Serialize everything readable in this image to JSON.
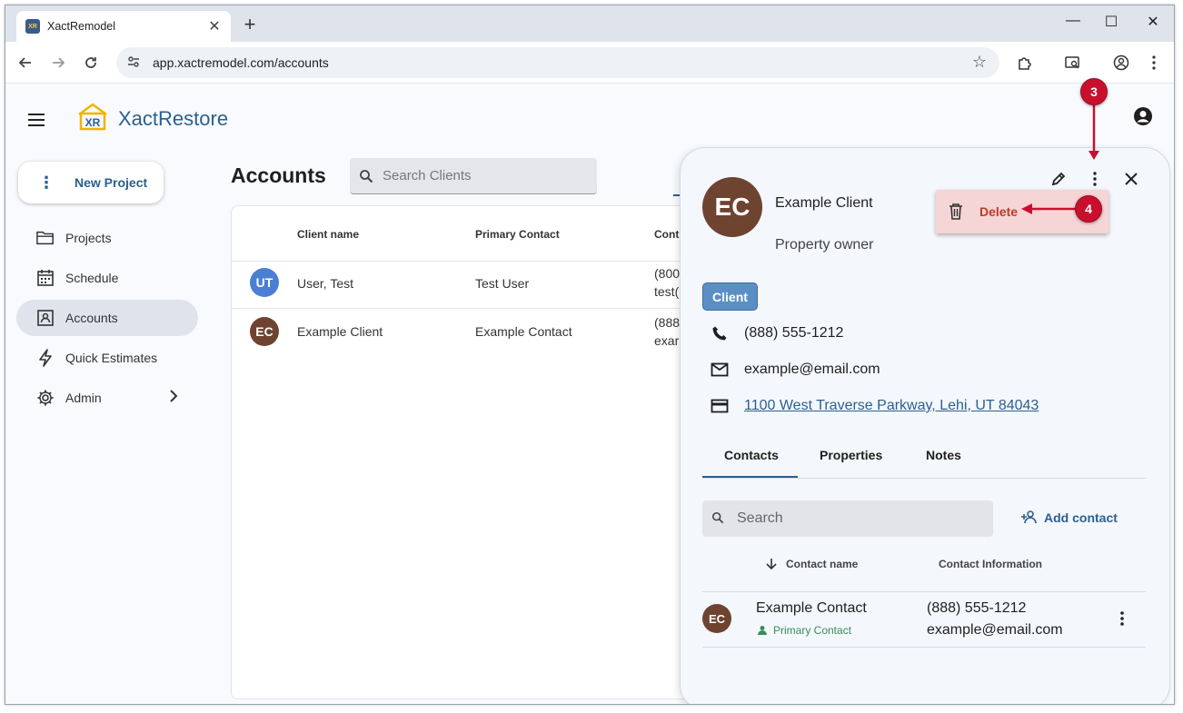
{
  "browser": {
    "tab_title": "XactRemodel",
    "favicon_text": "XR",
    "url": "app.xactremodel.com/accounts"
  },
  "app": {
    "logo_text": "XactRestore",
    "logo_badge": "XR",
    "new_project_label": "New Project",
    "nav": [
      {
        "label": "Projects",
        "icon": "folder-icon"
      },
      {
        "label": "Schedule",
        "icon": "calendar-icon"
      },
      {
        "label": "Accounts",
        "icon": "contact-card-icon",
        "active": true
      },
      {
        "label": "Quick Estimates",
        "icon": "lightning-icon"
      },
      {
        "label": "Admin",
        "icon": "gear-icon"
      }
    ]
  },
  "accounts": {
    "title": "Accounts",
    "search_placeholder": "Search Clients",
    "columns": [
      "Client name",
      "Primary Contact",
      "Cont"
    ],
    "rows": [
      {
        "initials": "UT",
        "avatar_color": "#4a7fd4",
        "name": "User, Test",
        "primary_contact": "Test User",
        "contact_line1": "(800",
        "contact_line2": "test("
      },
      {
        "initials": "EC",
        "avatar_color": "#6e4330",
        "name": "Example Client",
        "primary_contact": "Example Contact",
        "contact_line1": "(888",
        "contact_line2": "exar"
      }
    ]
  },
  "panel": {
    "initials": "EC",
    "name": "Example Client",
    "role": "Property owner",
    "badge": "Client",
    "phone": "(888) 555-1212",
    "email": "example@email.com",
    "address": "1100 West Traverse Parkway, Lehi, UT 84043",
    "tabs": [
      "Contacts",
      "Properties",
      "Notes"
    ],
    "search_placeholder": "Search",
    "add_contact_label": "Add contact",
    "columns": [
      "Contact name",
      "Contact Information"
    ],
    "contact": {
      "initials": "EC",
      "name": "Example Contact",
      "primary_label": "Primary Contact",
      "phone": "(888) 555-1212",
      "email": "example@email.com"
    }
  },
  "menu": {
    "delete_label": "Delete"
  },
  "callouts": {
    "three": "3",
    "four": "4"
  },
  "colors": {
    "brand_blue": "#2b5f91",
    "callout_red": "#c8102e",
    "delete_bg": "#f5d5d5"
  }
}
